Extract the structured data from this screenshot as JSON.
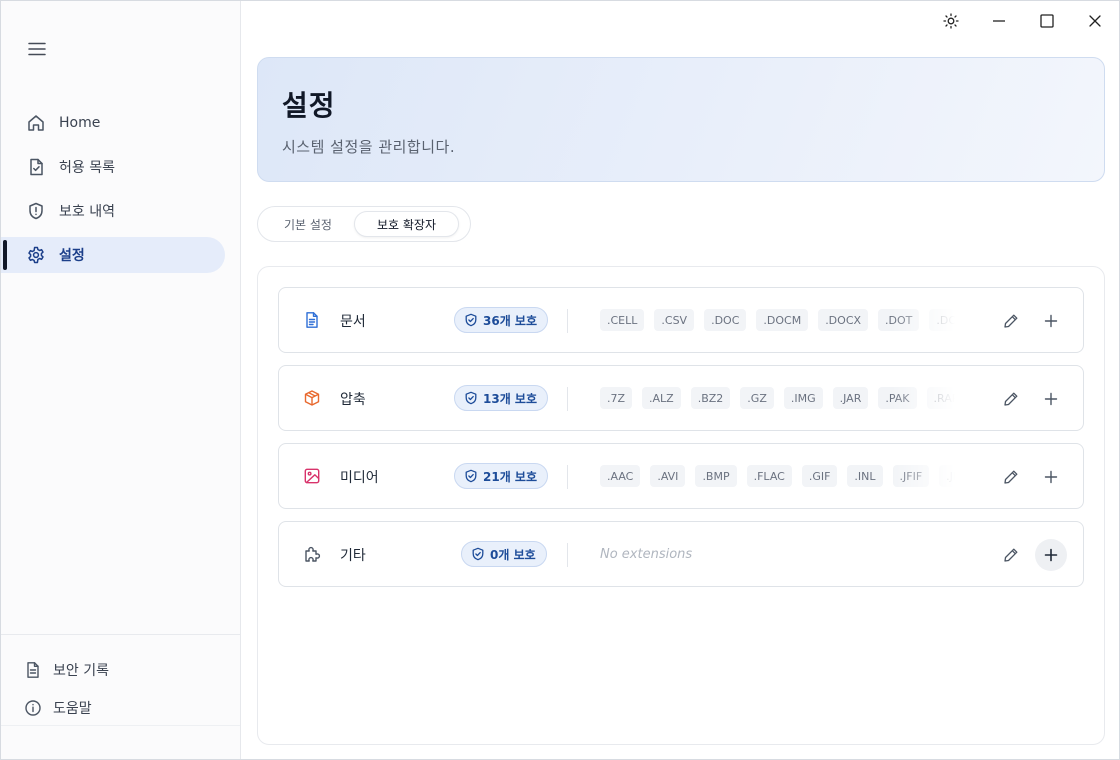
{
  "sidebar": {
    "items": [
      {
        "label": "Home"
      },
      {
        "label": "허용 목록"
      },
      {
        "label": "보호 내역"
      },
      {
        "label": "설정"
      }
    ],
    "footer": [
      {
        "label": "보안 기록"
      },
      {
        "label": "도움말"
      }
    ]
  },
  "header": {
    "title": "설정",
    "subtitle": "시스템 설정을 관리합니다."
  },
  "tabs": [
    {
      "label": "기본 설정"
    },
    {
      "label": "보호 확장자"
    }
  ],
  "categories": [
    {
      "name": "문서",
      "badge": "36개 보호",
      "icon": "document-icon",
      "extensions": [
        ".CELL",
        ".CSV",
        ".DOC",
        ".DOCM",
        ".DOCX",
        ".DOT",
        ".DOTM"
      ]
    },
    {
      "name": "압축",
      "badge": "13개 보호",
      "icon": "package-icon",
      "extensions": [
        ".7Z",
        ".ALZ",
        ".BZ2",
        ".GZ",
        ".IMG",
        ".JAR",
        ".PAK",
        ".RAR"
      ]
    },
    {
      "name": "미디어",
      "badge": "21개 보호",
      "icon": "image-icon",
      "extensions": [
        ".AAC",
        ".AVI",
        ".BMP",
        ".FLAC",
        ".GIF",
        ".INL",
        ".JFIF",
        ".JPEG"
      ]
    },
    {
      "name": "기타",
      "badge": "0개 보호",
      "icon": "puzzle-icon",
      "empty_text": "No extensions"
    }
  ],
  "colors": {
    "accent": "#1d4c99",
    "document": "#2f6fd6",
    "archive": "#e8692f",
    "media": "#d8336b"
  }
}
